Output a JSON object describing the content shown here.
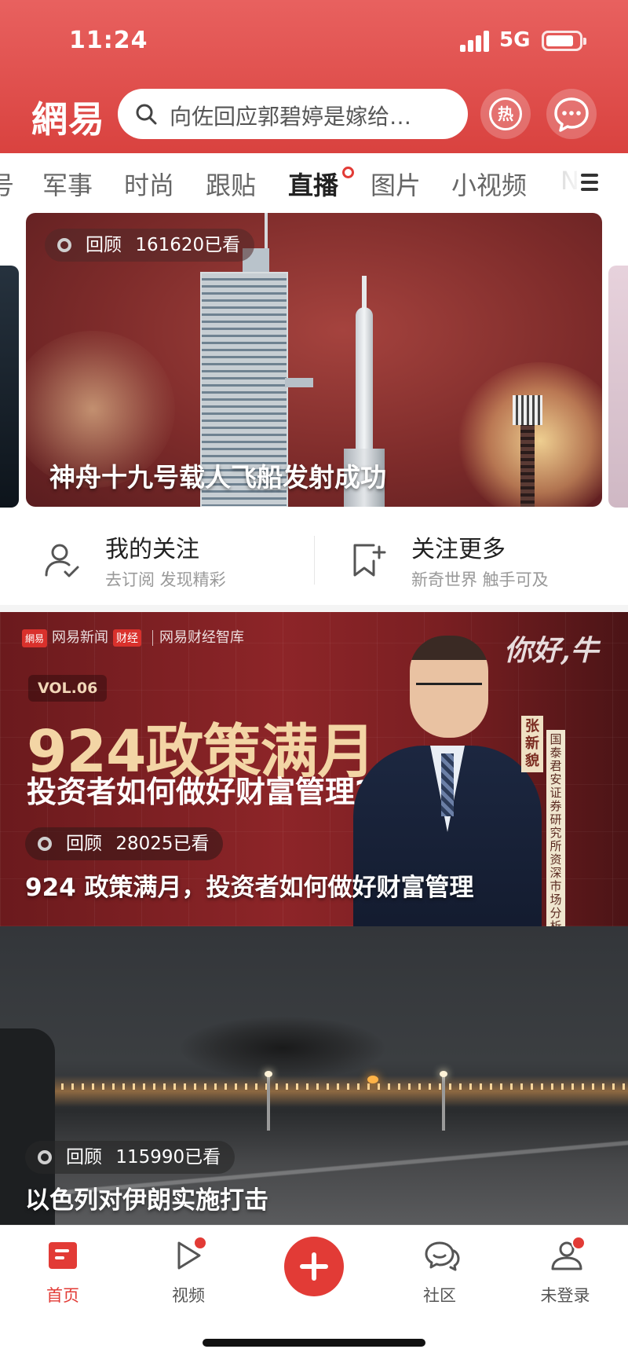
{
  "status_bar": {
    "time": "11:24",
    "network": "5G"
  },
  "header": {
    "logo": "網易",
    "search_placeholder": "向佐回应郭碧婷是嫁给…",
    "hot_label": "热"
  },
  "tabs": {
    "items": [
      "号",
      "军事",
      "时尚",
      "跟贴",
      "直播",
      "图片",
      "小视频",
      "N"
    ],
    "active": "直播"
  },
  "hero": {
    "status": "回顾",
    "views": "161620已看",
    "title": "神舟十九号载人飞船发射成功"
  },
  "follow": {
    "mine": {
      "title": "我的关注",
      "subtitle": "去订阅 发现精彩"
    },
    "more": {
      "title": "关注更多",
      "subtitle": "新奇世界 触手可及"
    }
  },
  "feed": [
    {
      "brand": {
        "mark": "網易",
        "name": "网易新闻",
        "tag": "财经",
        "sub": "网易财经智库"
      },
      "vol": "VOL.06",
      "headline_big": "924政策满月",
      "headline_sub": "投资者如何做好财富管理?",
      "show_name": "你好,牛",
      "host_name": "张新貌",
      "host_org": "国泰君安证券研究所资深市场分析师",
      "status": "回顾",
      "views": "28025已看",
      "title": "924 政策满月，投资者如何做好财富管理"
    },
    {
      "status": "回顾",
      "views": "115990已看",
      "title": "以色列对伊朗实施打击"
    }
  ],
  "bottom_nav": {
    "items": [
      {
        "label": "首页",
        "icon": "home-icon",
        "active": true
      },
      {
        "label": "视频",
        "icon": "video-icon",
        "dot": true
      },
      {
        "label": "社区",
        "icon": "community-icon"
      },
      {
        "label": "未登录",
        "icon": "profile-icon",
        "dot": true
      }
    ]
  },
  "colors": {
    "brand_red": "#e23b36",
    "header_red": "#d9423f"
  }
}
